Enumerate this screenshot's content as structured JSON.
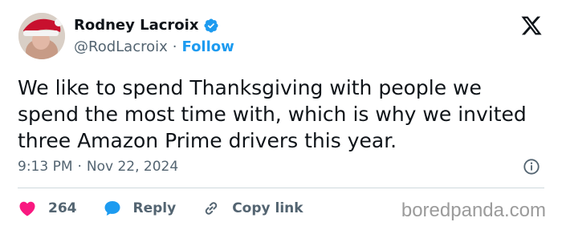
{
  "author": {
    "name": "Rodney Lacroix",
    "handle": "@RodLacroix",
    "separator": "·",
    "follow_label": "Follow",
    "verified_icon": "verified-badge-icon",
    "verified_color": "#1d9bf0"
  },
  "tweet": {
    "text": "We like to spend Thanksgiving with people we spend the most time with, which is why we invited three Amazon Prime drivers this year.",
    "time": "9:13 PM",
    "separator": "·",
    "date": "Nov 22, 2024"
  },
  "actions": {
    "likes_count": "264",
    "like_icon": "heart-icon",
    "like_color": "#f91880",
    "reply_label": "Reply",
    "reply_icon": "speech-bubble-icon",
    "reply_color": "#1d9bf0",
    "copy_label": "Copy link",
    "copy_icon": "link-icon"
  },
  "branding": {
    "platform_icon": "x-logo-icon",
    "watermark": "boredpanda.com"
  }
}
